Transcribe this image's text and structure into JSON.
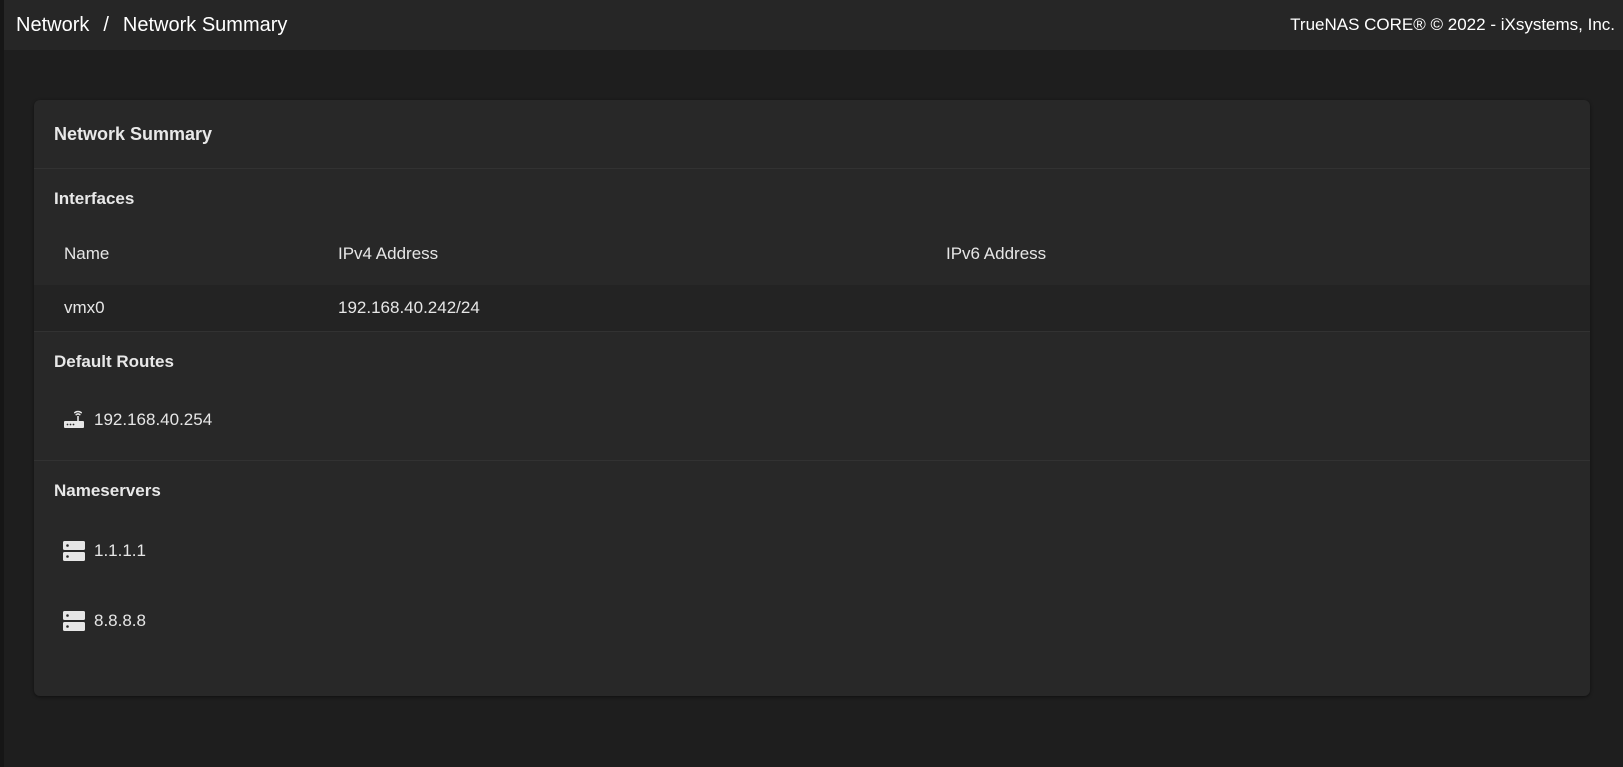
{
  "breadcrumb": {
    "items": [
      "Network",
      "Network Summary"
    ],
    "separator": "/"
  },
  "copyright": "TrueNAS CORE® © 2022 - iXsystems, Inc.",
  "card": {
    "title": "Network Summary",
    "interfaces": {
      "title": "Interfaces",
      "columns": [
        "Name",
        "IPv4 Address",
        "IPv6 Address"
      ],
      "rows": [
        {
          "name": "vmx0",
          "ipv4": "192.168.40.242/24",
          "ipv6": ""
        }
      ]
    },
    "default_routes": {
      "title": "Default Routes",
      "icon": "router-icon",
      "items": [
        "192.168.40.254"
      ]
    },
    "nameservers": {
      "title": "Nameservers",
      "icon": "dns-server-icon",
      "items": [
        "1.1.1.1",
        "8.8.8.8"
      ]
    }
  },
  "colors": {
    "page_bg": "#1e1e1e",
    "topbar_bg": "#262626",
    "card_bg": "#282828",
    "row_bg": "#232323",
    "text": "#e6e6e6"
  }
}
